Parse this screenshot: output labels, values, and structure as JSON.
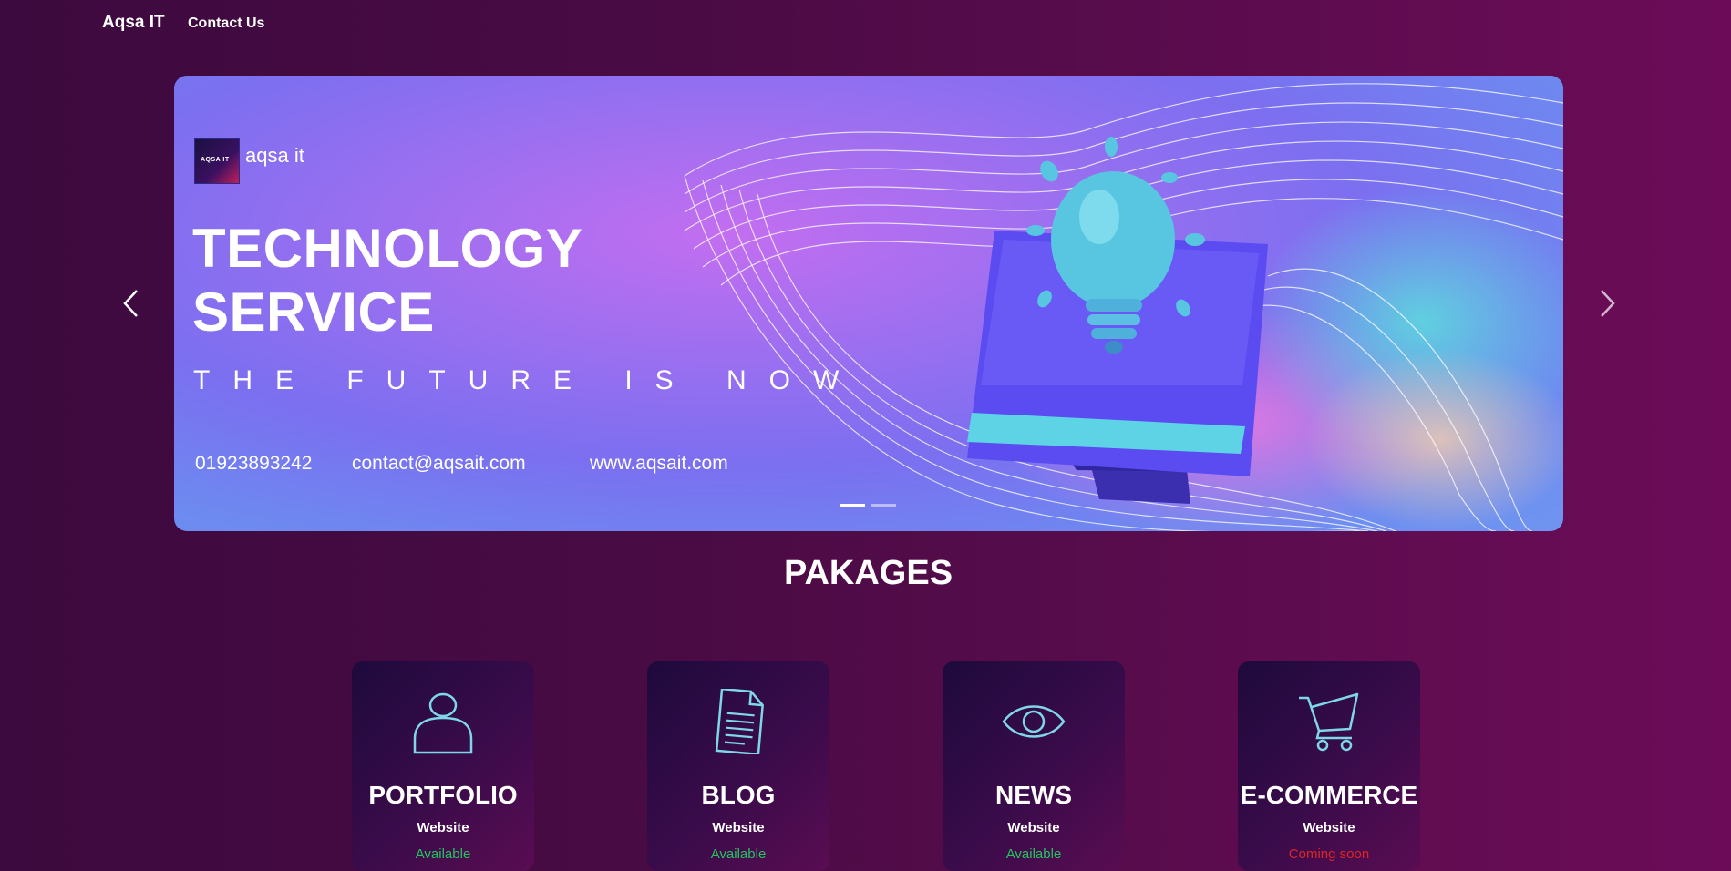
{
  "nav": {
    "brand": "Aqsa IT",
    "contact_link": "Contact Us"
  },
  "hero": {
    "logo_text": "aqsa it",
    "logo_mini": "AQSA IT",
    "title_line1": "TECHNOLOGY",
    "title_line2": "SERVICE",
    "subtitle": "THE FUTURE IS NOW",
    "phone": "01923893242",
    "email": "contact@aqsait.com",
    "website": "www.aqsait.com"
  },
  "carousel": {
    "slides": 2,
    "active_slide": 1
  },
  "packages": {
    "title": "PAKAGES",
    "items": [
      {
        "title": "PORTFOLIO",
        "subtitle": "Website",
        "status": "Available",
        "status_color": "#22c55e",
        "icon": "user-icon"
      },
      {
        "title": "BLOG",
        "subtitle": "Website",
        "status": "Available",
        "status_color": "#22c55e",
        "icon": "document-icon"
      },
      {
        "title": "NEWS",
        "subtitle": "Website",
        "status": "Available",
        "status_color": "#22c55e",
        "icon": "eye-icon"
      },
      {
        "title": "E-COMMERCE",
        "subtitle": "Website",
        "status": "Coming soon",
        "status_color": "#dc2626",
        "icon": "cart-icon"
      }
    ]
  },
  "colors": {
    "accent_icon": "#7fd6e8",
    "background": "#4a0b44"
  }
}
